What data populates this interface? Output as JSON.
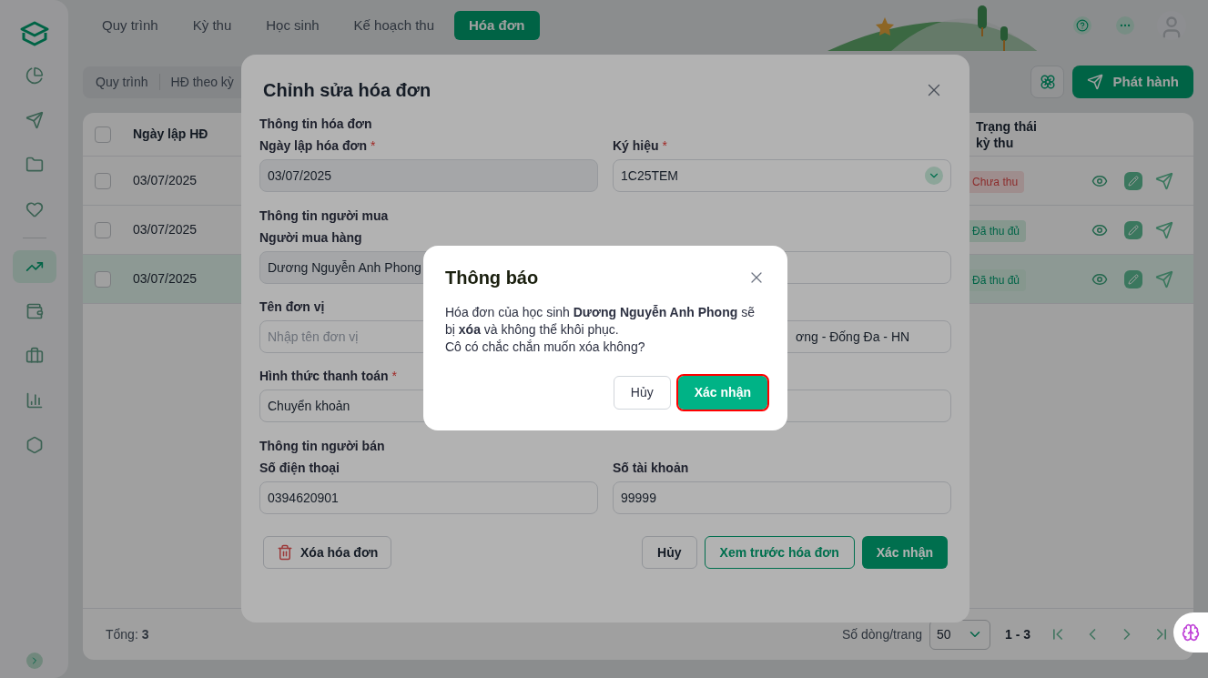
{
  "nav_tabs": [
    {
      "label": "Quy trình",
      "selected": false
    },
    {
      "label": "Kỳ thu",
      "selected": false
    },
    {
      "label": "Học sinh",
      "selected": false
    },
    {
      "label": "Kế hoạch thu",
      "selected": false
    },
    {
      "label": "Hóa đơn",
      "selected": true
    }
  ],
  "sidebar": {
    "items": [
      {
        "selected": false
      },
      {
        "selected": false
      },
      {
        "selected": false
      },
      {
        "selected": false
      },
      {
        "selected": true
      },
      {
        "selected": false
      },
      {
        "selected": false
      },
      {
        "selected": false
      },
      {
        "selected": false
      }
    ]
  },
  "toolbar": {
    "subtabs": [
      "Quy trình",
      "HĐ theo kỳ"
    ],
    "publish_button": "Phát hành"
  },
  "table": {
    "header_checked": false,
    "columns": [
      "Ngày lập HĐ",
      "Trạng thái kỳ thu"
    ],
    "rows": [
      {
        "checked": false,
        "selected": false,
        "date": "03/07/2025",
        "status": {
          "label": "Chưa thu",
          "kind": "unpaid"
        }
      },
      {
        "checked": false,
        "selected": false,
        "date": "03/07/2025",
        "status": {
          "label": "Đã thu đủ",
          "kind": "paid"
        }
      },
      {
        "checked": false,
        "selected": true,
        "date": "03/07/2025",
        "status": {
          "label": "Đã thu đủ",
          "kind": "paid"
        }
      }
    ]
  },
  "pagination": {
    "total": "Tổng: **3**",
    "rows_per_page_label": "Số dòng/trang",
    "rows_per_page": "50",
    "range": "1 - 3"
  },
  "edit_modal": {
    "title": "Chỉnh sửa hóa đơn",
    "sections": [
      {
        "title": "Thông tin hóa đơn",
        "fields": [
          {
            "label": "Ngày lập hóa đơn",
            "required_mark": "*",
            "kind": "text",
            "disabled": true,
            "value": "03/07/2025"
          },
          {
            "label": "Ký hiệu",
            "required_mark": "*",
            "kind": "select",
            "disabled": false,
            "value": "1C25TEM"
          }
        ]
      },
      {
        "title": "Thông tin người mua",
        "fields": [
          {
            "label": "Người mua hàng",
            "kind": "text",
            "disabled": true,
            "value": "Dương Nguyễn Anh Phong"
          },
          {
            "kind": "text",
            "disabled": false
          },
          {
            "label": "Tên đơn vị",
            "kind": "text",
            "disabled": false,
            "placeholder": "Nhập tên đơn vị"
          },
          {
            "kind": "covered",
            "disabled": false,
            "value": "ơng - Đống Đa - HN"
          },
          {
            "label": "Hình thức thanh toán",
            "required_mark": "*",
            "kind": "select",
            "disabled": false,
            "value": "Chuyển khoản"
          },
          {
            "kind": "text",
            "disabled": false
          }
        ]
      },
      {
        "title": "Thông tin người bán",
        "fields": [
          {
            "label": "Số điện thoại",
            "kind": "text",
            "disabled": false,
            "value": "0394620901"
          },
          {
            "label": "Số tài khoản",
            "kind": "text",
            "disabled": false,
            "value": "99999"
          }
        ]
      }
    ],
    "delete_button": "Xóa hóa đơn",
    "buttons": [
      {
        "label": "Hủy",
        "kind": "secondary"
      },
      {
        "label": "Xem trước hóa đơn",
        "kind": "outline"
      },
      {
        "label": "Xác nhận",
        "kind": "primary"
      }
    ]
  },
  "confirm_dialog": {
    "title": "Thông báo",
    "message": "Hóa đơn của học sinh **Dương Nguyễn Anh Phong** sẽ bị **xóa** và không thể khôi phục.\nCô có chắc chắn muốn xóa không?",
    "buttons": [
      {
        "label": "Hủy",
        "kind": "secondary",
        "focused": false
      },
      {
        "label": "Xác nhận",
        "kind": "primary",
        "focused": true
      }
    ]
  }
}
